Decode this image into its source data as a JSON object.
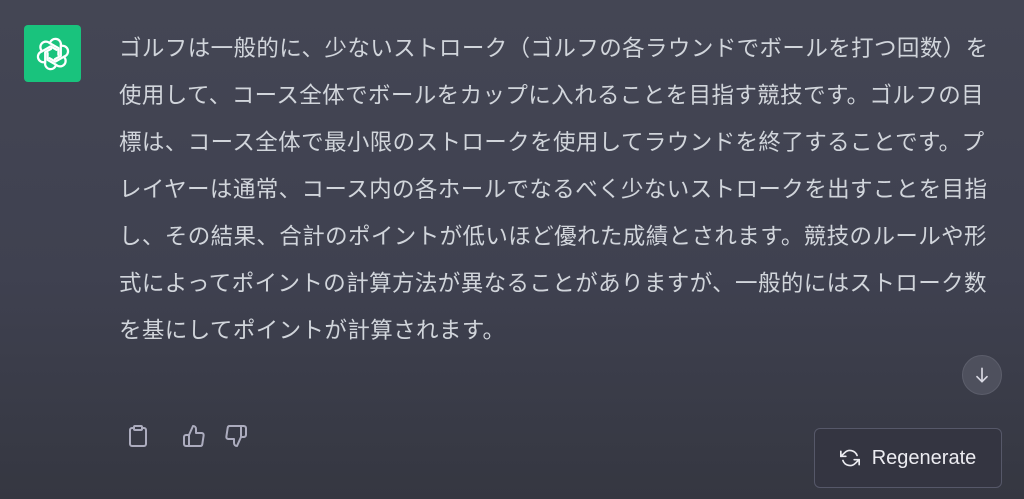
{
  "assistant": {
    "avatar_icon": "openai-logo-icon",
    "avatar_color": "#19c37d"
  },
  "message": {
    "text": "ゴルフは一般的に、少ないストローク（ゴルフの各ラウンドでボールを打つ回数）を使用して、コース全体でボールをカップに入れることを目指す競技です。ゴルフの目標は、コース全体で最小限のストロークを使用してラウンドを終了することです。プレイヤーは通常、コース内の各ホールでなるべく少ないストロークを出すことを目指し、その結果、合計のポイントが低いほど優れた成績とされます。競技のルールや形式によってポイントの計算方法が異なることがありますが、一般的にはストローク数を基にしてポイントが計算されます。"
  },
  "actions": {
    "copy_icon": "clipboard-icon",
    "like_icon": "thumbs-up-icon",
    "dislike_icon": "thumbs-down-icon"
  },
  "scroll": {
    "icon": "arrow-down-icon"
  },
  "regenerate": {
    "label": "Regenerate",
    "icon": "refresh-icon"
  },
  "colors": {
    "background": "#444654",
    "text": "#d1d5db",
    "button_border": "#565869"
  }
}
